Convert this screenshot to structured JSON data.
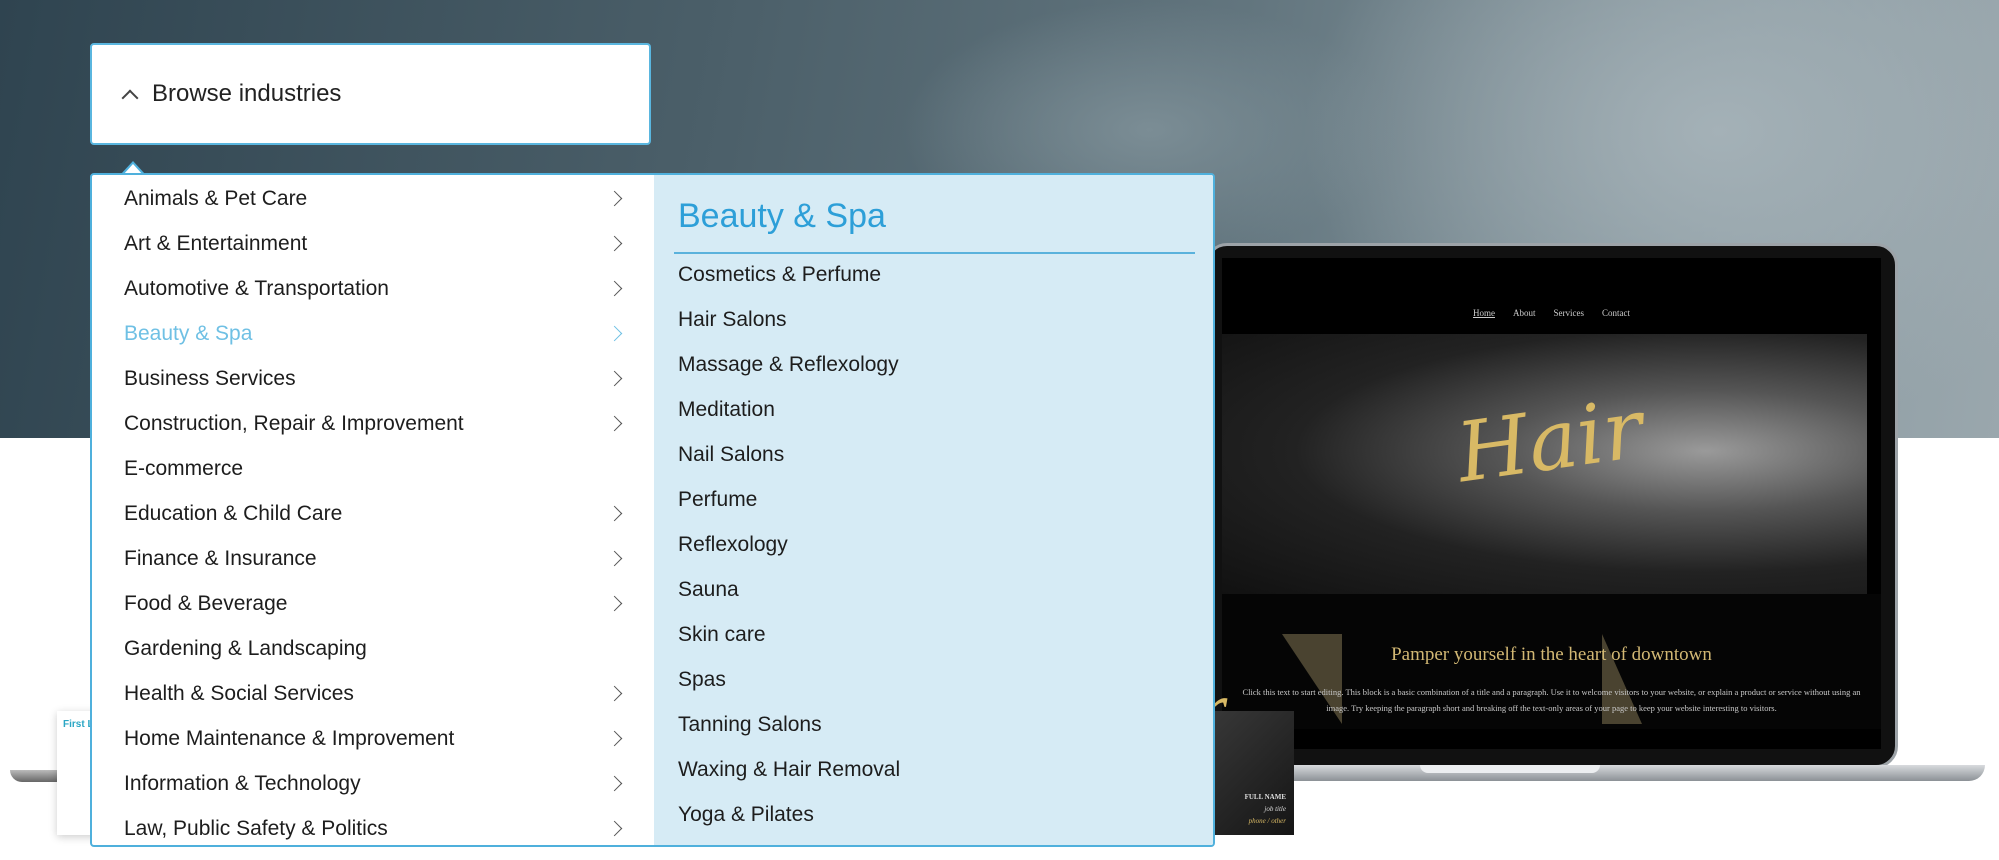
{
  "browse": {
    "label": "Browse industries",
    "icon": "chevron-up-icon"
  },
  "categories": [
    {
      "label": "Animals & Pet Care",
      "has_sub": true
    },
    {
      "label": "Art & Entertainment",
      "has_sub": true
    },
    {
      "label": "Automotive & Transportation",
      "has_sub": true
    },
    {
      "label": "Beauty & Spa",
      "has_sub": true,
      "active": true
    },
    {
      "label": "Business Services",
      "has_sub": true
    },
    {
      "label": "Construction, Repair & Improvement",
      "has_sub": true
    },
    {
      "label": "E-commerce",
      "has_sub": false
    },
    {
      "label": "Education & Child Care",
      "has_sub": true
    },
    {
      "label": "Finance & Insurance",
      "has_sub": true
    },
    {
      "label": "Food & Beverage",
      "has_sub": true
    },
    {
      "label": "Gardening & Landscaping",
      "has_sub": false
    },
    {
      "label": "Health & Social Services",
      "has_sub": true
    },
    {
      "label": "Home Maintenance & Improvement",
      "has_sub": true
    },
    {
      "label": "Information & Technology",
      "has_sub": true
    },
    {
      "label": "Law, Public Safety & Politics",
      "has_sub": true
    }
  ],
  "submenu": {
    "title": "Beauty & Spa",
    "items": [
      "Cosmetics & Perfume",
      "Hair Salons",
      "Massage & Reflexology",
      "Meditation",
      "Nail Salons",
      "Perfume",
      "Reflexology",
      "Sauna",
      "Skin care",
      "Spas",
      "Tanning Salons",
      "Waxing & Hair Removal",
      "Yoga & Pilates"
    ]
  },
  "preview": {
    "nav": [
      "Home",
      "About",
      "Services",
      "Contact"
    ],
    "hero_word": "Hair",
    "heading": "Pamper yourself in the heart of downtown",
    "paragraph": "Click this text to start editing. This block is a basic combination of a title and a paragraph. Use it to welcome visitors to your website, or explain a product or service without using an image. Try keeping the paragraph short and breaking off the text-only areas of your page to keep your website interesting to visitors.",
    "card_name": "FULL NAME",
    "card_title": "job title",
    "card_contact": "phone / other",
    "card_left_name": "First Last"
  },
  "colors": {
    "accent": "#2d9fd8",
    "active_item": "#6fc0e4",
    "submenu_bg": "#d6ebf5",
    "gold": "#d8b965"
  }
}
